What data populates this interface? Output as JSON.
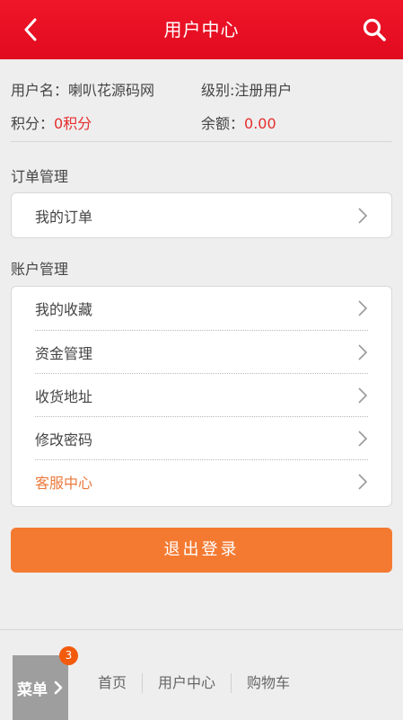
{
  "header": {
    "title": "用户中心",
    "back_icon": "chevron-left-icon",
    "search_icon": "search-icon",
    "background": "#e60d22"
  },
  "profile": {
    "username_label": "用户名：",
    "username_value": "喇叭花源码网",
    "level_label": "级别:",
    "level_value": "注册用户",
    "points_label": "积分：",
    "points_value": "0积分",
    "balance_label": "余额：",
    "balance_value": "0.00",
    "value_color": "#e62e2e"
  },
  "order_section": {
    "title": "订单管理",
    "items": [
      {
        "label": "我的订单",
        "icon": "chevron-right-icon"
      }
    ]
  },
  "account_section": {
    "title": "账户管理",
    "items": [
      {
        "label": "我的收藏",
        "icon": "chevron-right-icon"
      },
      {
        "label": "资金管理",
        "icon": "chevron-right-icon"
      },
      {
        "label": "收货地址",
        "icon": "chevron-right-icon"
      },
      {
        "label": "修改密码",
        "icon": "chevron-right-icon"
      },
      {
        "label": "客服中心",
        "icon": "chevron-right-icon",
        "color": "#ec7a3c"
      }
    ]
  },
  "logout": {
    "label": "退出登录",
    "color": "#f47a32"
  },
  "footer": {
    "menu_label": "菜单",
    "menu_icon": "chevron-right-icon",
    "badge_count": "3",
    "nav": [
      "首页",
      "用户中心",
      "购物车"
    ]
  }
}
